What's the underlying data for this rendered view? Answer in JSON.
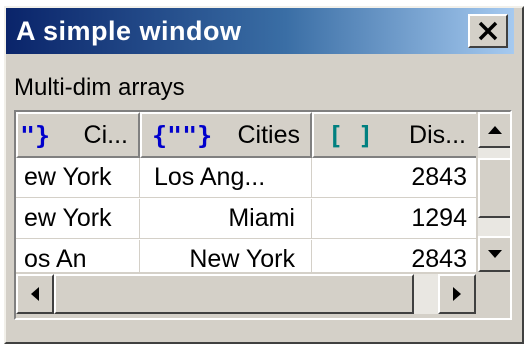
{
  "window": {
    "title": "A simple window"
  },
  "label": "Multi-dim arrays",
  "grid": {
    "columns": [
      {
        "icon": "string-array-icon",
        "icon_glyph": "\"}",
        "label": "Ci..."
      },
      {
        "icon": "string-array-icon",
        "icon_glyph": "{\"\"}",
        "label": "Cities"
      },
      {
        "icon": "number-array-icon",
        "icon_glyph": "[ ]",
        "label": "Dis..."
      }
    ],
    "rows": [
      [
        "ew York",
        "Los Ang...",
        "2843"
      ],
      [
        "ew York",
        "Miami",
        "1294"
      ],
      [
        "os An",
        "New York",
        "2843"
      ]
    ]
  },
  "colors": {
    "title_gradient_start": "#0a246a",
    "title_gradient_end": "#a6caf0",
    "string_icon": "#0000cc",
    "number_icon": "#008080"
  }
}
